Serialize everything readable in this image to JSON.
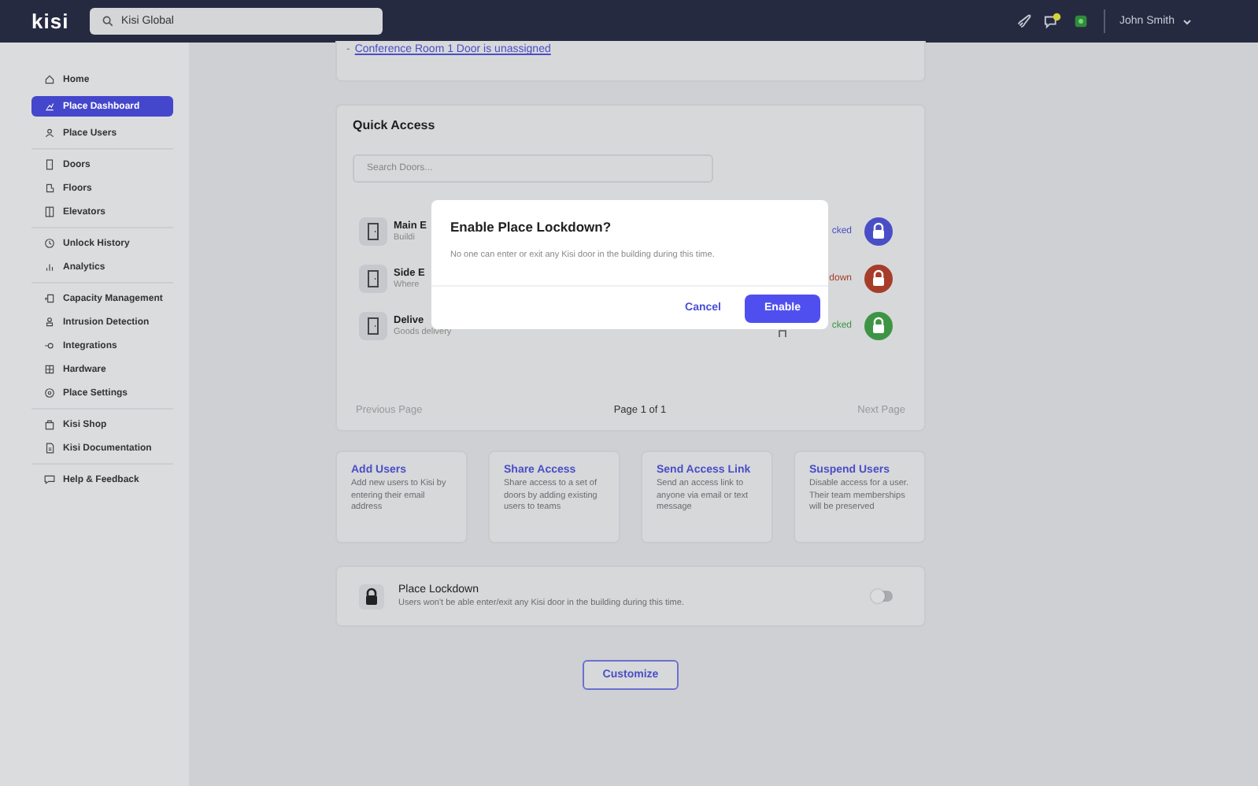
{
  "topbar": {
    "logo": "kisi",
    "search": {
      "value": "Kisi Global"
    },
    "user_name": "John Smith"
  },
  "sidebar": {
    "groups": [
      {
        "items": [
          {
            "label": "Home",
            "selected": false
          },
          {
            "label": "Place Dashboard",
            "selected": true
          },
          {
            "label": "Place Users",
            "selected": false
          }
        ]
      },
      {
        "items": [
          {
            "label": "Doors",
            "selected": false
          },
          {
            "label": "Floors",
            "selected": false
          },
          {
            "label": "Elevators",
            "selected": false
          }
        ]
      },
      {
        "items": [
          {
            "label": "Unlock History",
            "selected": false
          },
          {
            "label": "Analytics",
            "selected": false
          }
        ]
      },
      {
        "items": [
          {
            "label": "Capacity Management",
            "selected": false
          },
          {
            "label": "Intrusion Detection",
            "selected": false
          },
          {
            "label": "Integrations",
            "selected": false
          },
          {
            "label": "Hardware",
            "selected": false
          },
          {
            "label": "Place Settings",
            "selected": false
          }
        ]
      },
      {
        "items": [
          {
            "label": "Kisi Shop",
            "selected": false
          },
          {
            "label": "Kisi Documentation",
            "selected": false
          }
        ]
      },
      {
        "items": [
          {
            "label": "Help & Feedback",
            "selected": false
          }
        ]
      }
    ]
  },
  "alert": {
    "bullet": "-",
    "link": "Conference Room 1 Door is unassigned"
  },
  "quick_access": {
    "title": "Quick Access",
    "search": {
      "placeholder": "Search Doors..."
    },
    "doors": [
      {
        "title": "Main E",
        "subtitle": "Buildi",
        "status": "cked",
        "color": "#4a4ec6",
        "pinned": false
      },
      {
        "title": "Side E",
        "subtitle": "Where",
        "status": "down",
        "color": "#a63d2a",
        "pinned": false
      },
      {
        "title": "Delive",
        "subtitle": "Goods delivery",
        "status": "cked",
        "color": "#3e9445",
        "pinned": true
      }
    ],
    "pagination": {
      "previous": {
        "label": "Previous Page",
        "disabled": true
      },
      "page": "Page 1 of 1",
      "next": {
        "label": "Next Page",
        "disabled": true
      }
    }
  },
  "actions": [
    {
      "title": "Add Users",
      "description": "Add new users to Kisi by entering their email address"
    },
    {
      "title": "Share Access",
      "description": "Share access to a set of doors by adding existing users to teams"
    },
    {
      "title": "Send Access Link",
      "description": "Send an access link to anyone via email or text message"
    },
    {
      "title": "Suspend Users",
      "description": "Disable access for a user. Their team memberships will be preserved"
    }
  ],
  "lockdown": {
    "title": "Place Lockdown",
    "description": "Users won't be able enter/exit any Kisi door in the building during this time.",
    "on": false
  },
  "customize": "Customize",
  "modal": {
    "title": "Enable Place Lockdown?",
    "message": "No one can enter or exit any Kisi door in the building during this time.",
    "cancel": "Cancel",
    "confirm": "Enable"
  }
}
